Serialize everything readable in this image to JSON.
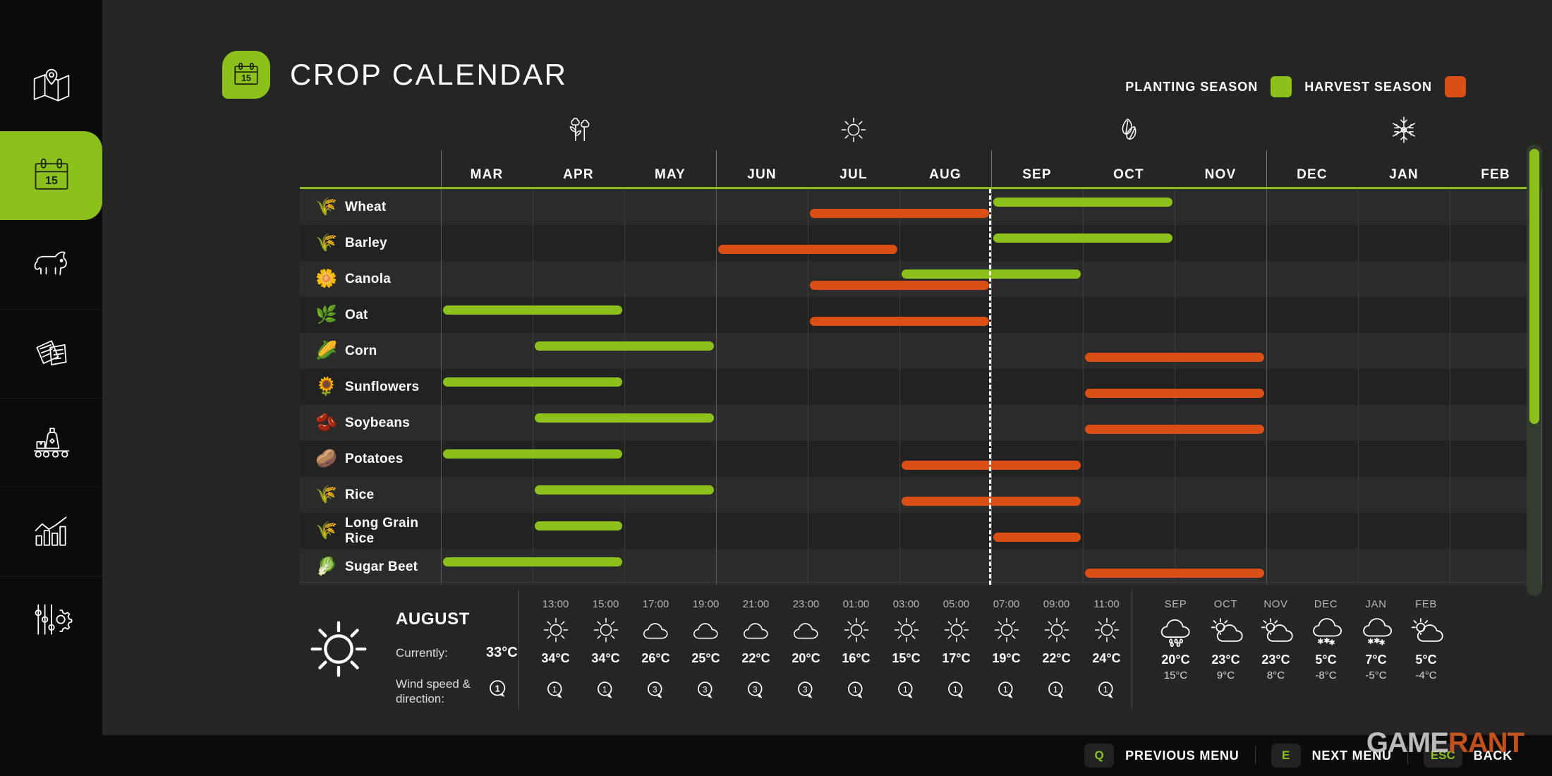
{
  "app": {
    "title": "CROP CALENDAR",
    "calendar_badge_day": "15"
  },
  "sidebar": {
    "items": [
      {
        "icon": "map-icon",
        "label": "Map",
        "active": false
      },
      {
        "icon": "calendar-icon",
        "label": "Crop Calendar",
        "active": true
      },
      {
        "icon": "cow-icon",
        "label": "Animals",
        "active": false
      },
      {
        "icon": "documents-icon",
        "label": "Contracts",
        "active": false
      },
      {
        "icon": "production-icon",
        "label": "Production",
        "active": false
      },
      {
        "icon": "statistics-icon",
        "label": "Statistics",
        "active": false
      },
      {
        "icon": "settings-sliders-icon",
        "label": "Settings",
        "active": false
      }
    ]
  },
  "legend": {
    "planting_label": "PLANTING SEASON",
    "planting_color": "#8cc01c",
    "harvest_label": "HARVEST SEASON",
    "harvest_color": "#d94f16"
  },
  "calendar": {
    "months": [
      "MAR",
      "APR",
      "MAY",
      "JUN",
      "JUL",
      "AUG",
      "SEP",
      "OCT",
      "NOV",
      "DEC",
      "JAN",
      "FEB"
    ],
    "seasons": [
      {
        "icon": "flower-icon",
        "name": "Spring",
        "center_month": "APR"
      },
      {
        "icon": "sun-icon",
        "name": "Summer",
        "center_month": "JUL"
      },
      {
        "icon": "leaf-icon",
        "name": "Autumn",
        "center_month": "OCT"
      },
      {
        "icon": "snowflake-icon",
        "name": "Winter",
        "center_month": "JAN"
      }
    ],
    "current_month_marker": "AUG",
    "rows": [
      {
        "emoji": "🌾",
        "name": "Wheat",
        "icon": "wheat-icon",
        "plant": [
          6,
          8
        ],
        "harvest": [
          4,
          6
        ]
      },
      {
        "emoji": "🌾",
        "name": "Barley",
        "icon": "barley-icon",
        "plant": [
          6,
          8
        ],
        "harvest": [
          3,
          5
        ]
      },
      {
        "emoji": "🌼",
        "name": "Canola",
        "icon": "canola-icon",
        "plant": [
          5,
          7
        ],
        "harvest": [
          4,
          6
        ]
      },
      {
        "emoji": "🌿",
        "name": "Oat",
        "icon": "oat-icon",
        "plant": [
          0,
          2
        ],
        "harvest": [
          4,
          6
        ]
      },
      {
        "emoji": "🌽",
        "name": "Corn",
        "icon": "corn-icon",
        "plant": [
          1,
          3
        ],
        "harvest": [
          7,
          9
        ]
      },
      {
        "emoji": "🌻",
        "name": "Sunflowers",
        "icon": "sunflower-icon",
        "plant": [
          0,
          2
        ],
        "harvest": [
          7,
          9
        ]
      },
      {
        "emoji": "🫘",
        "name": "Soybeans",
        "icon": "soybean-icon",
        "plant": [
          1,
          3
        ],
        "harvest": [
          7,
          9
        ]
      },
      {
        "emoji": "🥔",
        "name": "Potatoes",
        "icon": "potato-icon",
        "plant": [
          0,
          2
        ],
        "harvest": [
          5,
          7
        ]
      },
      {
        "emoji": "🌾",
        "name": "Rice",
        "icon": "rice-icon",
        "plant": [
          1,
          3
        ],
        "harvest": [
          5,
          7
        ]
      },
      {
        "emoji": "🌾",
        "name": "Long Grain Rice",
        "icon": "long-grain-rice-icon",
        "plant": [
          1,
          2
        ],
        "harvest": [
          6,
          7
        ]
      },
      {
        "emoji": "🥬",
        "name": "Sugar Beet",
        "icon": "sugar-beet-icon",
        "plant": [
          0,
          2
        ],
        "harvest": [
          7,
          9
        ]
      }
    ]
  },
  "weather": {
    "icon": "sun-icon",
    "month": "AUGUST",
    "currently_label": "Currently:",
    "currently_value": "33°C",
    "wind_label": "Wind speed & direction:",
    "wind_value": "1",
    "hourly": [
      {
        "time": "13:00",
        "icon": "sun-icon",
        "temp": "34°C",
        "wind": "1"
      },
      {
        "time": "15:00",
        "icon": "sun-icon",
        "temp": "34°C",
        "wind": "1"
      },
      {
        "time": "17:00",
        "icon": "cloud-icon",
        "temp": "26°C",
        "wind": "3"
      },
      {
        "time": "19:00",
        "icon": "cloud-icon",
        "temp": "25°C",
        "wind": "3"
      },
      {
        "time": "21:00",
        "icon": "cloud-icon",
        "temp": "22°C",
        "wind": "3"
      },
      {
        "time": "23:00",
        "icon": "cloud-icon",
        "temp": "20°C",
        "wind": "3"
      },
      {
        "time": "01:00",
        "icon": "sun-icon",
        "temp": "16°C",
        "wind": "1"
      },
      {
        "time": "03:00",
        "icon": "sun-icon",
        "temp": "15°C",
        "wind": "1"
      },
      {
        "time": "05:00",
        "icon": "sun-icon",
        "temp": "17°C",
        "wind": "1"
      },
      {
        "time": "07:00",
        "icon": "sun-icon",
        "temp": "19°C",
        "wind": "1"
      },
      {
        "time": "09:00",
        "icon": "sun-icon",
        "temp": "22°C",
        "wind": "1"
      },
      {
        "time": "11:00",
        "icon": "sun-icon",
        "temp": "24°C",
        "wind": "1"
      }
    ],
    "monthly": [
      {
        "month": "SEP",
        "icon": "rain-icon",
        "high": "20°C",
        "low": "15°C"
      },
      {
        "month": "OCT",
        "icon": "sun-cloud-icon",
        "high": "23°C",
        "low": "9°C"
      },
      {
        "month": "NOV",
        "icon": "sun-cloud-icon",
        "high": "23°C",
        "low": "8°C"
      },
      {
        "month": "DEC",
        "icon": "snow-icon",
        "high": "5°C",
        "low": "-8°C"
      },
      {
        "month": "JAN",
        "icon": "snow-icon",
        "high": "7°C",
        "low": "-5°C"
      },
      {
        "month": "FEB",
        "icon": "sun-cloud-icon",
        "high": "5°C",
        "low": "-4°C"
      }
    ]
  },
  "bottom_bar": {
    "hints": [
      {
        "key": "Q",
        "label": "PREVIOUS MENU"
      },
      {
        "key": "E",
        "label": "NEXT MENU"
      },
      {
        "key": "ESC",
        "label": "BACK"
      }
    ]
  },
  "watermark": {
    "part1": "GAME",
    "part2": "RANT"
  }
}
